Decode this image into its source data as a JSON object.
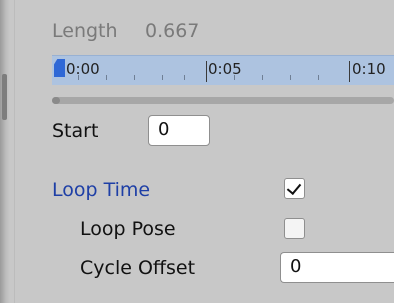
{
  "clip": {
    "length_label": "Length",
    "length_value": "0.667"
  },
  "timeline": {
    "labels": [
      "0:00",
      "0:05",
      "0:10"
    ],
    "accent": "#adc3e0",
    "marker_color": "#2f68d6"
  },
  "fields": {
    "start_label": "Start",
    "start_value": "0",
    "loop_time_label": "Loop Time",
    "loop_time_checked": true,
    "loop_pose_label": "Loop Pose",
    "loop_pose_checked": false,
    "cycle_offset_label": "Cycle Offset",
    "cycle_offset_value": "0"
  },
  "colors": {
    "loop_time_text": "#1e3fa6",
    "panel_bg": "#c8c8c8"
  }
}
